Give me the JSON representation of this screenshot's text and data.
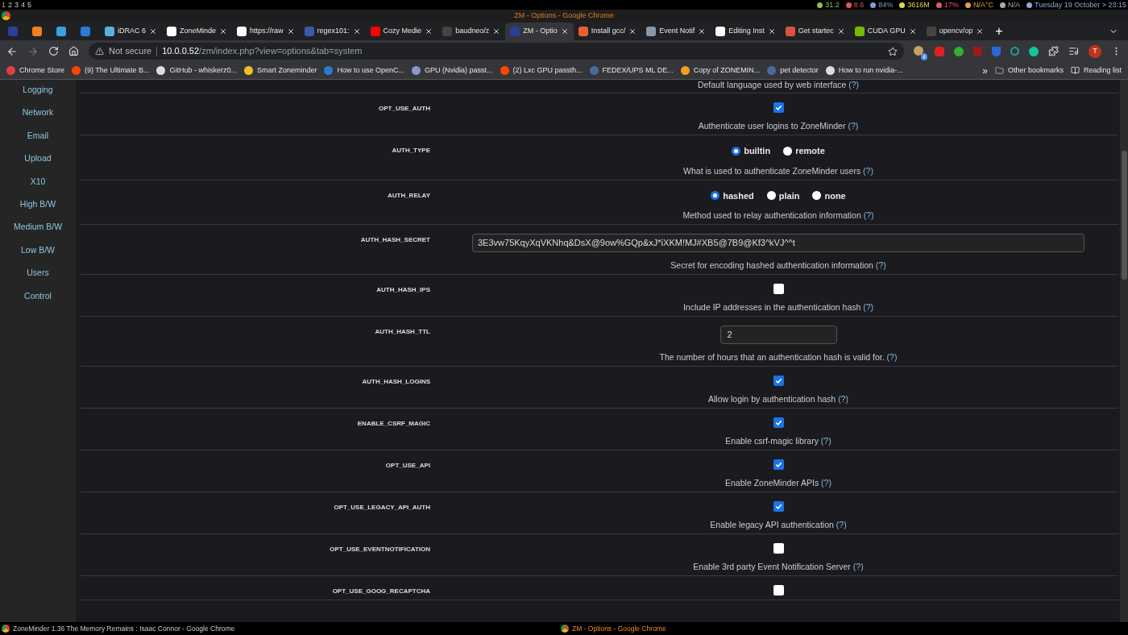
{
  "workspaces": [
    {
      "label": "1",
      "selected": true
    },
    {
      "label": "2",
      "selected": false
    },
    {
      "label": "3",
      "selected": false
    },
    {
      "label": "4",
      "selected": false
    },
    {
      "label": "5",
      "selected": false
    }
  ],
  "tray": [
    {
      "text": "31.2",
      "color": "#8bc34a"
    },
    {
      "text": "8.6",
      "color": "#e05555"
    },
    {
      "text": "84%",
      "color": "#7f9fd8"
    },
    {
      "text": "3616M",
      "color": "#e6d84a"
    },
    {
      "text": "17%",
      "color": "#e05577"
    },
    {
      "text": "N/A°C",
      "color": "#e0a040"
    },
    {
      "text": "N/A",
      "color": "#aaaaaa"
    },
    {
      "text": "Tuesday 19 October > 23:15",
      "color": "#8fa8d8"
    }
  ],
  "window_title": "ZM - Options - Google Chrome",
  "tabs": [
    {
      "color": "#2a3f9a",
      "selected": false
    },
    {
      "color": "#f08020",
      "selected": false
    },
    {
      "color": "#3aa0e0",
      "selected": false
    },
    {
      "color": "#2a7ad8",
      "selected": false
    },
    {
      "title": "iDRAC 6",
      "color": "#5ab0e0",
      "selected": false
    },
    {
      "title": "ZoneMinde",
      "color": "#ffffff",
      "selected": false
    },
    {
      "title": "https://raw",
      "color": "#ffffff",
      "selected": false
    },
    {
      "title": "regex101: ",
      "color": "#3a5aa8",
      "selected": false
    },
    {
      "title": "Cozy Medie",
      "color": "#ff0000",
      "selected": false
    },
    {
      "title": "baudneo/z",
      "color": "#444444",
      "selected": false
    },
    {
      "title": "ZM - Optio",
      "color": "#2a3f9a",
      "selected": true
    },
    {
      "title": "Install gcc/",
      "color": "#e86030",
      "selected": false
    },
    {
      "title": "Event Notif",
      "color": "#8899aa",
      "selected": false
    },
    {
      "title": "Editing Inst",
      "color": "#ffffff",
      "selected": false
    },
    {
      "title": "Get startec",
      "color": "#e05040",
      "selected": false
    },
    {
      "title": "CUDA GPU",
      "color": "#76b900",
      "selected": false
    },
    {
      "title": "opencv/op",
      "color": "#444444",
      "selected": false
    }
  ],
  "new_tab": "+",
  "address": {
    "security": "Not secure",
    "host": "10.0.0.52",
    "path": "/zm/index.php?view=options&tab=system"
  },
  "profile_initial": "T",
  "extension_badge": "4",
  "bookmarks": [
    {
      "title": "Chrome Store",
      "color": "#e04040"
    },
    {
      "title": "(9) The Ultimate B...",
      "color": "#ff4500"
    },
    {
      "title": "GitHub - whiskerz0...",
      "color": "#dddddd"
    },
    {
      "title": "Smart Zoneminder",
      "color": "#f0c020"
    },
    {
      "title": "How to use OpenC...",
      "color": "#2a7ad8"
    },
    {
      "title": "GPU (Nvidia) passt...",
      "color": "#8899cc"
    },
    {
      "title": "(2) Lxc GPU passth...",
      "color": "#ff4500"
    },
    {
      "title": "FEDEX/UPS ML DE...",
      "color": "#4a6a9a"
    },
    {
      "title": "Copy of ZONEMIN...",
      "color": "#f0a020"
    },
    {
      "title": "pet detector",
      "color": "#4a6a9a"
    },
    {
      "title": "How to run nvidia-...",
      "color": "#dddddd"
    }
  ],
  "bookmarks_more": "»",
  "other_bookmarks": "Other bookmarks",
  "reading_list": "Reading list",
  "sidebar": [
    "Logging",
    "Network",
    "Email",
    "Upload",
    "X10",
    "High B/W",
    "Medium B/W",
    "Low B/W",
    "Users",
    "Control"
  ],
  "options": [
    {
      "kind": "partial",
      "description": "Default language used by web interface",
      "help": "(?)"
    },
    {
      "kind": "checkbox",
      "name": "OPT_USE_AUTH",
      "checked": true,
      "description": "Authenticate user logins to ZoneMinder",
      "help": "(?)"
    },
    {
      "kind": "radio",
      "name": "AUTH_TYPE",
      "choices": [
        {
          "label": "builtin",
          "selected": true
        },
        {
          "label": "remote",
          "selected": false
        }
      ],
      "description": "What is used to authenticate ZoneMinder users",
      "help": "(?)"
    },
    {
      "kind": "radio",
      "name": "AUTH_RELAY",
      "choices": [
        {
          "label": "hashed",
          "selected": true
        },
        {
          "label": "plain",
          "selected": false
        },
        {
          "label": "none",
          "selected": false
        }
      ],
      "description": "Method used to relay authentication information",
      "help": "(?)"
    },
    {
      "kind": "text",
      "name": "AUTH_HASH_SECRET",
      "value": "3E3vw75KqyXqVKNhq&DsX@9ow%GQp&xJ*iXKM!MJ#XB5@7B9@Kf3^kVJ^^t",
      "description": "Secret for encoding hashed authentication information",
      "help": "(?)"
    },
    {
      "kind": "checkbox",
      "name": "AUTH_HASH_IPS",
      "checked": false,
      "description": "Include IP addresses in the authentication hash",
      "help": "(?)"
    },
    {
      "kind": "number",
      "name": "AUTH_HASH_TTL",
      "value": "2",
      "description": "The number of hours that an authentication hash is valid for.",
      "help": "(?)"
    },
    {
      "kind": "checkbox",
      "name": "AUTH_HASH_LOGINS",
      "checked": true,
      "description": "Allow login by authentication hash",
      "help": "(?)"
    },
    {
      "kind": "checkbox",
      "name": "ENABLE_CSRF_MAGIC",
      "checked": true,
      "description": "Enable csrf-magic library",
      "help": "(?)"
    },
    {
      "kind": "checkbox",
      "name": "OPT_USE_API",
      "checked": true,
      "description": "Enable ZoneMinder APIs",
      "help": "(?)"
    },
    {
      "kind": "checkbox",
      "name": "OPT_USE_LEGACY_API_AUTH",
      "checked": true,
      "description": "Enable legacy API authentication",
      "help": "(?)"
    },
    {
      "kind": "checkbox",
      "name": "OPT_USE_EVENTNOTIFICATION",
      "checked": false,
      "description": "Enable 3rd party Event Notification Server",
      "help": "(?)"
    },
    {
      "kind": "checkbox",
      "name": "OPT_USE_GOOG_RECAPTCHA",
      "checked": false
    }
  ],
  "taskbar": {
    "left": "ZoneMinder 1.36 The Memory Remains : Isaac Connor - Google Chrome",
    "center": "ZM - Options - Google Chrome"
  }
}
